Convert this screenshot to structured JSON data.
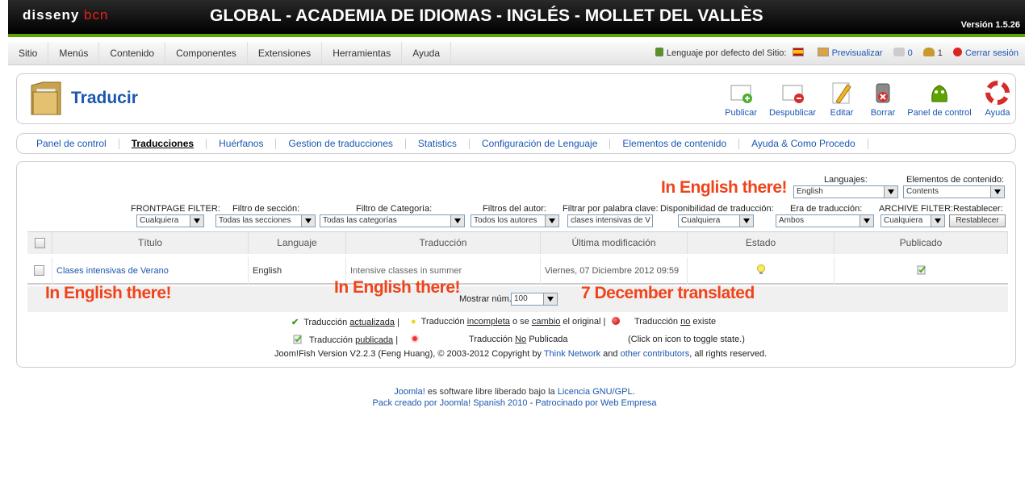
{
  "header": {
    "logo_main": "disseny",
    "logo_accent": "bcn",
    "site_title": "GLOBAL - ACADEMIA DE IDIOMAS - INGLÉS - MOLLET DEL VALLÈS",
    "version": "Versión 1.5.26"
  },
  "menu": [
    "Sitio",
    "Menús",
    "Contenido",
    "Componentes",
    "Extensiones",
    "Herramientas",
    "Ayuda"
  ],
  "status": {
    "default_lang_label": "Lenguaje por defecto del Sitio:",
    "preview": "Previsualizar",
    "messages": "0",
    "users": "1",
    "logout": "Cerrar sesión"
  },
  "toolbar": {
    "title": "Traducir",
    "buttons": [
      "Publicar",
      "Despublicar",
      "Editar",
      "Borrar",
      "Panel de control",
      "Ayuda"
    ]
  },
  "submenu": [
    "Panel de control",
    "Traducciones",
    "Huérfanos",
    "Gestion de traducciones",
    "Statistics",
    "Configuración de Lenguaje",
    "Elementos de contenido",
    "Ayuda & Como Procedo"
  ],
  "filters": {
    "languages_label": "Languajes:",
    "languages_value": "English",
    "content_elements_label": "Elementos de contenido:",
    "content_elements_value": "Contents",
    "frontpage_label": "FRONTPAGE FILTER:",
    "frontpage_value": "Cualquiera",
    "section_label": "Filtro de sección:",
    "section_value": "Todas las secciones",
    "category_label": "Filtro de Categoría:",
    "category_value": "Todas las categorías",
    "author_label": "Filtros del autor:",
    "author_value": "Todos los autores",
    "keyword_label": "Filtrar por palabra clave:",
    "keyword_value": "clases intensivas de V",
    "availability_label": "Disponibilidad de traducción:",
    "availability_value": "Cualquiera",
    "era_label": "Era de traducción:",
    "era_value": "Ambos",
    "archive_label": "ARCHIVE FILTER:",
    "archive_value": "Cualquiera",
    "reset_label": "Restablecer:",
    "reset_button": "Restablecer"
  },
  "table": {
    "columns": [
      "Título",
      "Languaje",
      "Traducción",
      "Última modificación",
      "Estado",
      "Publicado"
    ],
    "rows": [
      {
        "title": "Clases intensivas de Verano",
        "language": "English",
        "translation": "Intensive classes in summer",
        "modified": "Viernes, 07 Diciembre 2012 09:59",
        "state_icon": "lightbulb-icon",
        "published_icon": "published-doc-icon"
      }
    ],
    "show_num_label": "Mostrar núm.",
    "show_num_value": "100"
  },
  "legend": {
    "updated_pre": "Traducción",
    "updated_u": "actualizada",
    "updated_post": "|",
    "incomplete_pre": "Traducción",
    "incomplete_u1": "incompleta",
    "incomplete_mid": "o se",
    "incomplete_u2": "cambio",
    "incomplete_post": "el original |",
    "notexist_pre": "Traducción",
    "notexist_u": "no",
    "notexist_post": "existe",
    "published_pre": "Traducción",
    "published_u": "publicada",
    "published_post": "|",
    "notpublished_pre": "Traducción",
    "notpublished_u": "No",
    "notpublished_post": "Publicada",
    "toggle_hint": "(Click on icon to toggle state.)",
    "copyright_pre": "Joom!Fish Version V2.2.3 (Feng Huang), © 2003-2012 Copyright by",
    "copyright_link1": "Think Network",
    "copyright_and": "and",
    "copyright_link2": "other contributors",
    "copyright_post": ", all rights reserved."
  },
  "annotations": {
    "a1": "In English there!",
    "a2": "In English there!",
    "a3": "In English there!",
    "a4": "7 December translated"
  },
  "footer": {
    "line1_link": "Joomla!",
    "line1_mid": "es software libre liberado bajo la",
    "line1_link2": "Licencia GNU/GPL",
    "line1_end": ".",
    "line2_a": "Pack creado por Joomla! Spanish 2010",
    "line2_sep": "-",
    "line2_b": "Patrocinado por Web Empresa"
  },
  "colors": {
    "brand_green": "#5ea400",
    "link_blue": "#1b57b1",
    "annotation_red": "#f0431a"
  }
}
